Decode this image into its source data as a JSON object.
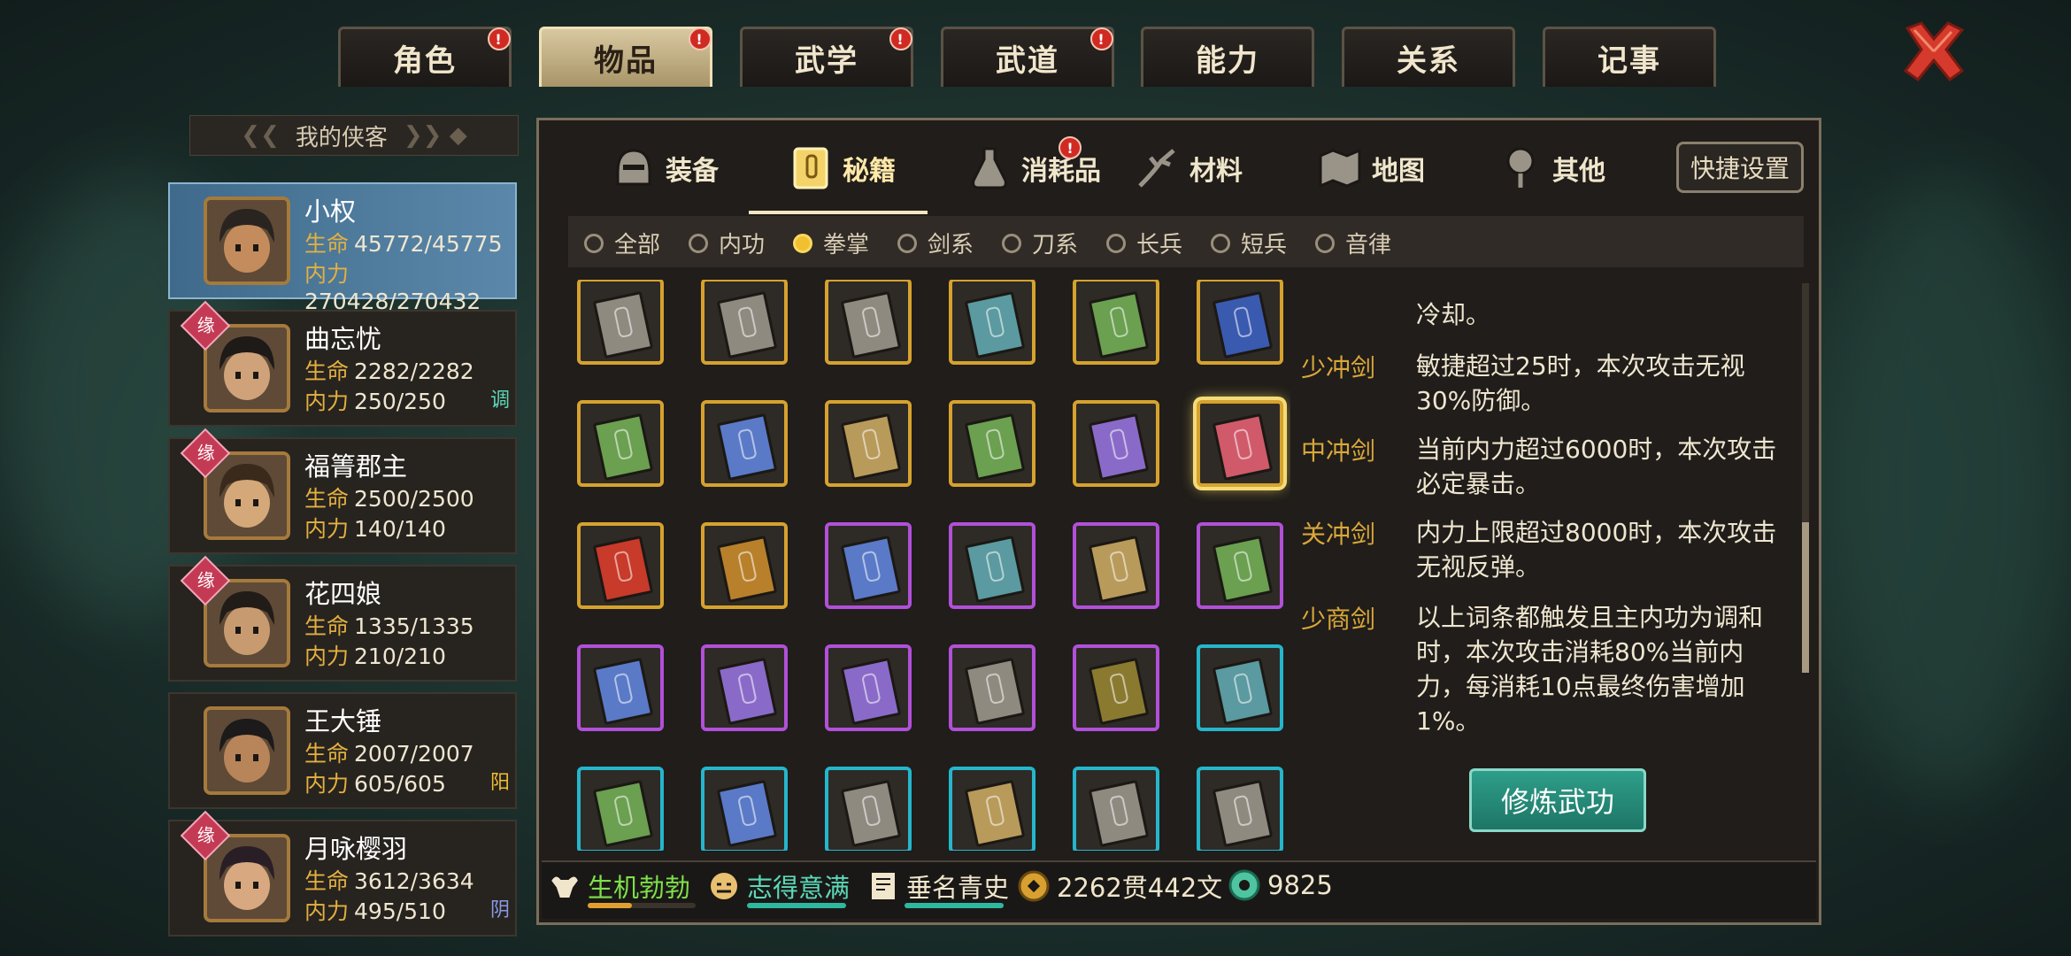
{
  "top_tabs": [
    {
      "label": "角色",
      "badge": "!"
    },
    {
      "label": "物品",
      "badge": "!"
    },
    {
      "label": "武学",
      "badge": "!"
    },
    {
      "label": "武道",
      "badge": "!"
    },
    {
      "label": "能力",
      "badge": ""
    },
    {
      "label": "关系",
      "badge": ""
    },
    {
      "label": "记事",
      "badge": ""
    }
  ],
  "roster": {
    "title": "我的侠客",
    "hp_label": "生命",
    "mp_label": "内力",
    "yuan_label": "缘",
    "members": [
      {
        "name": "小权",
        "hp": "45772/45775",
        "mp": "270428/270432",
        "tag": ""
      },
      {
        "name": "曲忘忧",
        "hp": "2282/2282",
        "mp": "250/250",
        "tag": "调"
      },
      {
        "name": "福箐郡主",
        "hp": "2500/2500",
        "mp": "140/140",
        "tag": ""
      },
      {
        "name": "花四娘",
        "hp": "1335/1335",
        "mp": "210/210",
        "tag": ""
      },
      {
        "name": "王大锤",
        "hp": "2007/2007",
        "mp": "605/605",
        "tag": "阳"
      },
      {
        "name": "月咏樱羽",
        "hp": "3612/3634",
        "mp": "495/510",
        "tag": "阴"
      }
    ]
  },
  "sub_tabs": [
    "装备",
    "秘籍",
    "消耗品",
    "材料",
    "地图",
    "其他"
  ],
  "quick_settings": "快捷设置",
  "filters": [
    "全部",
    "内功",
    "拳掌",
    "剑系",
    "刀系",
    "长兵",
    "短兵",
    "音律"
  ],
  "selected_filter": "拳掌",
  "description": [
    {
      "k": "",
      "v": "冷却。"
    },
    {
      "k": "少冲剑",
      "v": "敏捷超过25时，本次攻击无视30%防御。"
    },
    {
      "k": "中冲剑",
      "v": "当前内力超过6000时，本次攻击必定暴击。"
    },
    {
      "k": "关冲剑",
      "v": "内力上限超过8000时，本次攻击无视反弹。"
    },
    {
      "k": "少商剑",
      "v": "以上词条都触发且主内功为调和时，本次攻击消耗80%当前内力，每消耗10点最终伤害增加1%。"
    }
  ],
  "train_button": "修炼武功",
  "status": {
    "s1": "生机勃勃",
    "s2": "志得意满",
    "s3": "垂名青史",
    "money": "2262贯442文",
    "jade": "9825"
  },
  "colors": {
    "gold": "#d6a22e",
    "purple": "#b150d8",
    "cyan": "#25b6cc",
    "accent": "#2e9e8a"
  },
  "grid_books": [
    [
      "gray",
      "gray",
      "gray",
      "teal",
      "green",
      "blueseal"
    ],
    [
      "green",
      "blue",
      "tan",
      "green",
      "purple",
      "red"
    ],
    [
      "redtome",
      "smallgold",
      "blue",
      "teal",
      "tan",
      "green"
    ],
    [
      "blue",
      "purple",
      "purple",
      "gray",
      "olive",
      "teal"
    ],
    [
      "green",
      "blue",
      "gray",
      "tan",
      "gray",
      "gray"
    ]
  ],
  "grid_frames": [
    [
      "gold",
      "gold",
      "gold",
      "gold",
      "gold",
      "gold"
    ],
    [
      "gold",
      "gold",
      "gold",
      "gold",
      "gold",
      "gold"
    ],
    [
      "gold",
      "gold",
      "purple",
      "purple",
      "purple",
      "purple"
    ],
    [
      "purple",
      "purple",
      "purple",
      "purple",
      "purple",
      "cyan"
    ],
    [
      "cyan",
      "cyan",
      "cyan",
      "cyan",
      "cyan",
      "cyan"
    ]
  ]
}
